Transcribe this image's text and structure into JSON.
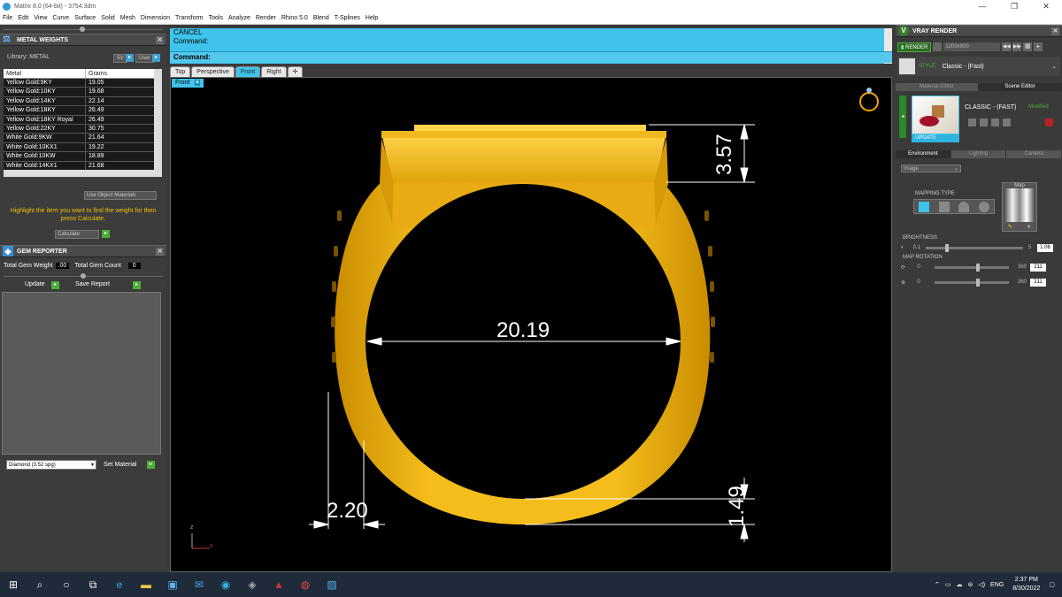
{
  "window": {
    "title": "Matrix 8.0 (64-bit) - 3754.3dm"
  },
  "menu": [
    "File",
    "Edit",
    "View",
    "Curve",
    "Surface",
    "Solid",
    "Mesh",
    "Dimension",
    "Transform",
    "Tools",
    "Analyze",
    "Render",
    "Rhino 5.0",
    "Blend",
    "T-Splines",
    "Help"
  ],
  "metal_weights": {
    "title": "METAL WEIGHTS",
    "library_label": "Library: METAL",
    "sv_btn": "SV",
    "user_btn": "User",
    "col_metal": "Metal",
    "col_grams": "Grams",
    "rows": [
      {
        "metal": "Yellow Gold:9KY",
        "grams": "19.05"
      },
      {
        "metal": "Yellow Gold:10KY",
        "grams": "19.68"
      },
      {
        "metal": "Yellow Gold:14KY",
        "grams": "22.14"
      },
      {
        "metal": "Yellow Gold:18KY",
        "grams": "26.49"
      },
      {
        "metal": "Yellow Gold:18KY Royal",
        "grams": "26.49"
      },
      {
        "metal": "Yellow Gold:22KY",
        "grams": "30.75"
      },
      {
        "metal": "White Gold:9KW",
        "grams": "21.64"
      },
      {
        "metal": "White Gold:10KX1",
        "grams": "19.22"
      },
      {
        "metal": "White Gold:10KW",
        "grams": "18.89"
      },
      {
        "metal": "White Gold:14KX1",
        "grams": "21.68"
      }
    ],
    "use_object_materials": "Use Object Materials",
    "instruction": "Highlight the item you want to find the weight for then press Calculate.",
    "calculate": "Calculate"
  },
  "gem_reporter": {
    "title": "GEM REPORTER",
    "total_gem_weight_label": "Total Gem Weight",
    "total_gem_weight": ".00",
    "total_gem_count_label": "Total Gem Count",
    "total_gem_count": "0",
    "update": "Update",
    "save_report": "Save Report",
    "material_select": "Diamond    (3.52 spg)",
    "set_material": "Set Material"
  },
  "command": {
    "line1": "CANCEL",
    "line2": "Command:",
    "prompt": "Command:"
  },
  "viewport_tabs": [
    "Top",
    "Perspective",
    "Front",
    "Right"
  ],
  "active_viewport": "Front",
  "viewport_label": "Front",
  "dimensions": {
    "inner_diameter": "20.19",
    "top_height": "3.57",
    "shank_width": "2.20",
    "shank_bottom": "1.49"
  },
  "axis": {
    "z": "z",
    "x": "x"
  },
  "vray": {
    "title": "VRAY RENDER",
    "render_btn": "RENDER",
    "resolution": "1200x900",
    "style_label": "STYLE:",
    "style_value": "Classic - (Fast)",
    "tabs": [
      "Material Editor",
      "Scene Editor"
    ],
    "active_tab": "Scene Editor",
    "scene_name": "CLASSIC - (FAST)",
    "scene_status": "Modified",
    "update_label": "UPDATE",
    "sub_tabs": [
      "Environment",
      "Lighting",
      "Camera"
    ],
    "active_sub_tab": "Environment",
    "env_type": "Image",
    "mapping_type_label": "MAPPING TYPE",
    "map_label": "Map",
    "brightness_label": "BRIGHTNESS",
    "brightness_min": "0.1",
    "brightness_max": "5",
    "brightness_value": "1.06",
    "map_rotation_label": "MAP ROTATION",
    "rotation1_min": "0",
    "rotation1_max": "360",
    "rotation1_value": "211",
    "rotation2_min": "0",
    "rotation2_max": "360",
    "rotation2_value": "211"
  },
  "taskbar": {
    "lang": "ENG",
    "time": "2:37 PM",
    "date": "8/30/2022"
  },
  "colors": {
    "accent": "#3fc3eb",
    "gold": "#f2b517",
    "green": "#4caf3a"
  }
}
